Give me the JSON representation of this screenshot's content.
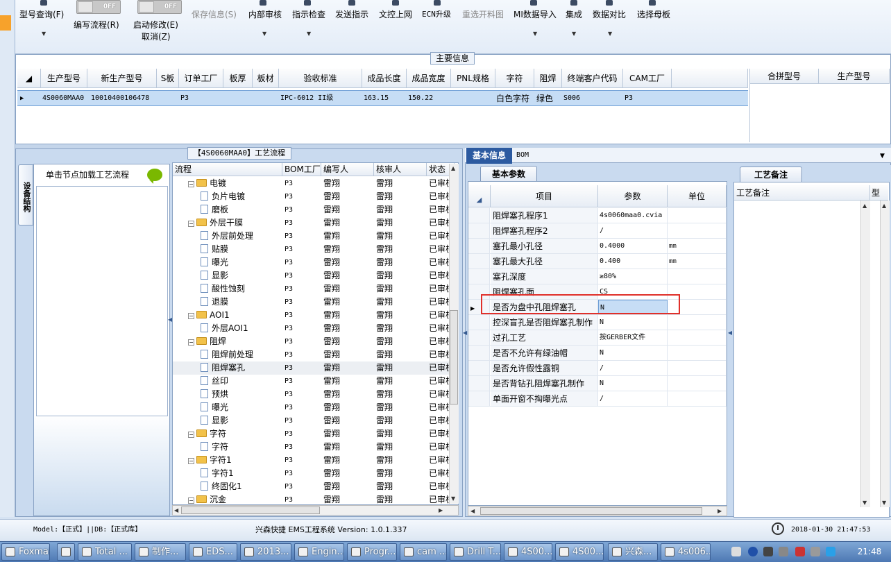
{
  "toolbar": {
    "items": [
      {
        "label": "型号查询(F)",
        "dropdown": true
      },
      {
        "label": "编写流程(R)",
        "toggle": "OFF"
      },
      {
        "label": "启动修改(E)",
        "label2": "取消(Z)",
        "toggle": "OFF"
      },
      {
        "label": "保存信息(S)",
        "disabled": true
      },
      {
        "label": "内部审核",
        "dropdown": true
      },
      {
        "label": "指示检查",
        "dropdown": true
      },
      {
        "label": "发送指示"
      },
      {
        "label": "文控上网"
      },
      {
        "label": "ECN升级"
      },
      {
        "label": "重选开料图",
        "disabled": true
      },
      {
        "label": "MI数据导入",
        "dropdown": true
      },
      {
        "label": "集成",
        "dropdown": true
      },
      {
        "label": "数据对比",
        "dropdown": true
      },
      {
        "label": "选择母板"
      }
    ]
  },
  "main_info": {
    "title": "主要信息",
    "columns": [
      "生产型号",
      "新生产型号",
      "S板",
      "订单工厂",
      "板厚",
      "板材",
      "验收标准",
      "成品长度",
      "成品宽度",
      "PNL规格",
      "字符",
      "阻焊",
      "终端客户代码",
      "CAM工厂"
    ],
    "row": [
      "4S0060MAA0",
      "10010400106478",
      "",
      "P3",
      "",
      "",
      "IPC-6012 II级",
      "163.15",
      "150.22",
      "",
      "白色字符",
      "绿色",
      "S006",
      "P3"
    ],
    "merge_columns": [
      "合拼型号",
      "生产型号"
    ]
  },
  "process_panel": {
    "title": "【4S0060MAA0】工艺流程",
    "side_tab": "设备结构",
    "device_header": "单击节点加载工艺流程",
    "tree_columns": [
      "流程",
      "BOM工厂",
      "编写人",
      "核审人",
      "状态"
    ],
    "rows": [
      {
        "name": "电镀",
        "level": 0,
        "folder": true,
        "bom": "P3",
        "writer": "雷翔",
        "reviewer": "雷翔",
        "status": "已审核"
      },
      {
        "name": "负片电镀",
        "level": 1,
        "folder": false,
        "bom": "P3",
        "writer": "雷翔",
        "reviewer": "雷翔",
        "status": "已审核"
      },
      {
        "name": "磨板",
        "level": 1,
        "folder": false,
        "bom": "P3",
        "writer": "雷翔",
        "reviewer": "雷翔",
        "status": "已审核"
      },
      {
        "name": "外层干膜",
        "level": 0,
        "folder": true,
        "bom": "P3",
        "writer": "雷翔",
        "reviewer": "雷翔",
        "status": "已审核"
      },
      {
        "name": "外层前处理",
        "level": 1,
        "folder": false,
        "bom": "P3",
        "writer": "雷翔",
        "reviewer": "雷翔",
        "status": "已审核"
      },
      {
        "name": "贴膜",
        "level": 1,
        "folder": false,
        "bom": "P3",
        "writer": "雷翔",
        "reviewer": "雷翔",
        "status": "已审核"
      },
      {
        "name": "曝光",
        "level": 1,
        "folder": false,
        "bom": "P3",
        "writer": "雷翔",
        "reviewer": "雷翔",
        "status": "已审核"
      },
      {
        "name": "显影",
        "level": 1,
        "folder": false,
        "bom": "P3",
        "writer": "雷翔",
        "reviewer": "雷翔",
        "status": "已审核"
      },
      {
        "name": "酸性蚀刻",
        "level": 1,
        "folder": false,
        "bom": "P3",
        "writer": "雷翔",
        "reviewer": "雷翔",
        "status": "已审核"
      },
      {
        "name": "退膜",
        "level": 1,
        "folder": false,
        "bom": "P3",
        "writer": "雷翔",
        "reviewer": "雷翔",
        "status": "已审核"
      },
      {
        "name": "AOI1",
        "level": 0,
        "folder": true,
        "bom": "P3",
        "writer": "雷翔",
        "reviewer": "雷翔",
        "status": "已审核"
      },
      {
        "name": "外层AOI1",
        "level": 1,
        "folder": false,
        "bom": "P3",
        "writer": "雷翔",
        "reviewer": "雷翔",
        "status": "已审核"
      },
      {
        "name": "阻焊",
        "level": 0,
        "folder": true,
        "bom": "P3",
        "writer": "雷翔",
        "reviewer": "雷翔",
        "status": "已审核"
      },
      {
        "name": "阻焊前处理",
        "level": 1,
        "folder": false,
        "bom": "P3",
        "writer": "雷翔",
        "reviewer": "雷翔",
        "status": "已审核"
      },
      {
        "name": "阻焊塞孔",
        "level": 1,
        "folder": false,
        "bom": "P3",
        "writer": "雷翔",
        "reviewer": "雷翔",
        "status": "已审核",
        "selected": true
      },
      {
        "name": "丝印",
        "level": 1,
        "folder": false,
        "bom": "P3",
        "writer": "雷翔",
        "reviewer": "雷翔",
        "status": "已审核"
      },
      {
        "name": "预烘",
        "level": 1,
        "folder": false,
        "bom": "P3",
        "writer": "雷翔",
        "reviewer": "雷翔",
        "status": "已审核"
      },
      {
        "name": "曝光",
        "level": 1,
        "folder": false,
        "bom": "P3",
        "writer": "雷翔",
        "reviewer": "雷翔",
        "status": "已审核"
      },
      {
        "name": "显影",
        "level": 1,
        "folder": false,
        "bom": "P3",
        "writer": "雷翔",
        "reviewer": "雷翔",
        "status": "已审核"
      },
      {
        "name": "字符",
        "level": 0,
        "folder": true,
        "bom": "P3",
        "writer": "雷翔",
        "reviewer": "雷翔",
        "status": "已审核"
      },
      {
        "name": "字符",
        "level": 1,
        "folder": false,
        "bom": "P3",
        "writer": "雷翔",
        "reviewer": "雷翔",
        "status": "已审核"
      },
      {
        "name": "字符1",
        "level": 0,
        "folder": true,
        "bom": "P3",
        "writer": "雷翔",
        "reviewer": "雷翔",
        "status": "已审核"
      },
      {
        "name": "字符1",
        "level": 1,
        "folder": false,
        "bom": "P3",
        "writer": "雷翔",
        "reviewer": "雷翔",
        "status": "已审核"
      },
      {
        "name": "终固化1",
        "level": 1,
        "folder": false,
        "bom": "P3",
        "writer": "雷翔",
        "reviewer": "雷翔",
        "status": "已审核"
      },
      {
        "name": "沉金",
        "level": 0,
        "folder": true,
        "bom": "P3",
        "writer": "雷翔",
        "reviewer": "雷翔",
        "status": "已审核"
      }
    ]
  },
  "right_panel": {
    "tabs": [
      "基本信息",
      "BOM"
    ],
    "subtab": "基本参数",
    "param_columns": [
      "项目",
      "参数",
      "单位"
    ],
    "params": [
      {
        "name": "阻焊塞孔程序1",
        "value": "4s0060maa0.cvia",
        "unit": ""
      },
      {
        "name": "阻焊塞孔程序2",
        "value": "/",
        "unit": ""
      },
      {
        "name": "塞孔最小孔径",
        "value": "0.4000",
        "unit": "mm"
      },
      {
        "name": "塞孔最大孔径",
        "value": "0.400",
        "unit": "mm"
      },
      {
        "name": "塞孔深度",
        "value": "≥80%",
        "unit": ""
      },
      {
        "name": "阻焊塞孔面",
        "value": "CS",
        "unit": ""
      },
      {
        "name": "是否为盘中孔阻焊塞孔",
        "value": "N",
        "unit": "",
        "selected": true
      },
      {
        "name": "控深盲孔是否阻焊塞孔制作",
        "value": "N",
        "unit": ""
      },
      {
        "name": "过孔工艺",
        "value": "按GERBER文件",
        "unit": ""
      },
      {
        "name": "是否不允许有绿油帽",
        "value": "N",
        "unit": ""
      },
      {
        "name": "是否允许假性露铜",
        "value": "/",
        "unit": ""
      },
      {
        "name": "是否背钻孔阻焊塞孔制作",
        "value": "N",
        "unit": ""
      },
      {
        "name": "单面开窗不掏曝光点",
        "value": "/",
        "unit": ""
      }
    ],
    "notes_tab": "工艺备注",
    "notes_columns": [
      "工艺备注",
      "型"
    ]
  },
  "status_bar": {
    "model": "Model:【正式】||DB:【正式库】",
    "app": "兴森快捷 EMS工程系统 Version: 1.0.1.337",
    "datetime": "2018-01-30 21:47:53"
  },
  "taskbar": {
    "items": [
      "Foxmail",
      "",
      "Total ...",
      "制作...",
      "EDS...",
      "2013...",
      "Engin...",
      "Progr...",
      "cam ...",
      "Drill T...",
      "4S00...",
      "4S00...",
      "兴森...",
      "4s006..."
    ],
    "clock": "21:48"
  },
  "colors": {
    "accent": "#2c5aa0",
    "selection": "#c6ddf5",
    "highlight_box": "#e0302a",
    "folder": "#f2c24a"
  }
}
